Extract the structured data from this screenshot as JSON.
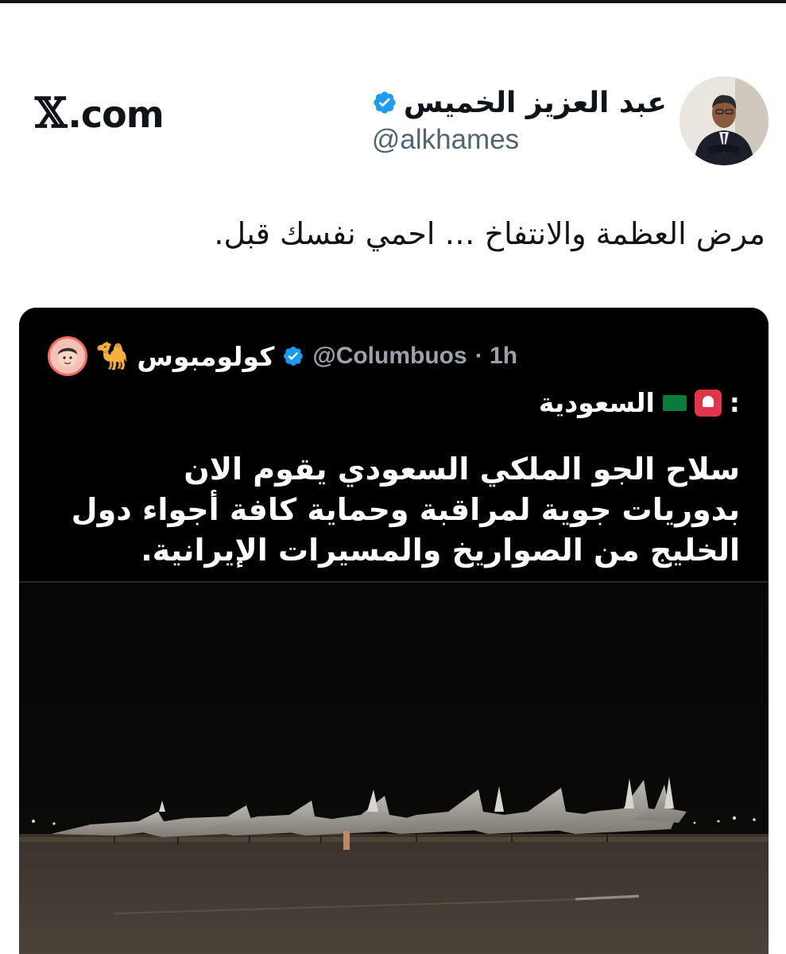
{
  "brand": {
    "logo_icon": "x-logo-icon",
    "text": ".com",
    "mark": "𝕏"
  },
  "author": {
    "name": "عبد العزيز الخميس",
    "handle": "@alkhames",
    "verified": true,
    "verified_color": "#1d9bf0"
  },
  "tweet": {
    "text": "مرض العظمة والانتفاخ … احمي نفسك قبل."
  },
  "quoted_post": {
    "avatar_icon": "cartoon-avatar-icon",
    "camel_icon": "🐪",
    "name": "كولومبوس",
    "verified": true,
    "handle": "@Columbuos",
    "time": "· 1h",
    "tag": "السعودية",
    "flag_icon": "saudi-flag-icon",
    "siren_icon": "siren-icon",
    "colon": ":",
    "body": "سلاح الجو الملكي السعودي يقوم الان بدوريات جوية لمراقبة وحماية كافة أجواء دول الخليج من الصواريخ والمسيرات الإيرانية."
  },
  "photo": {
    "description_icon": "night-airbase-fighter-jets-image"
  }
}
